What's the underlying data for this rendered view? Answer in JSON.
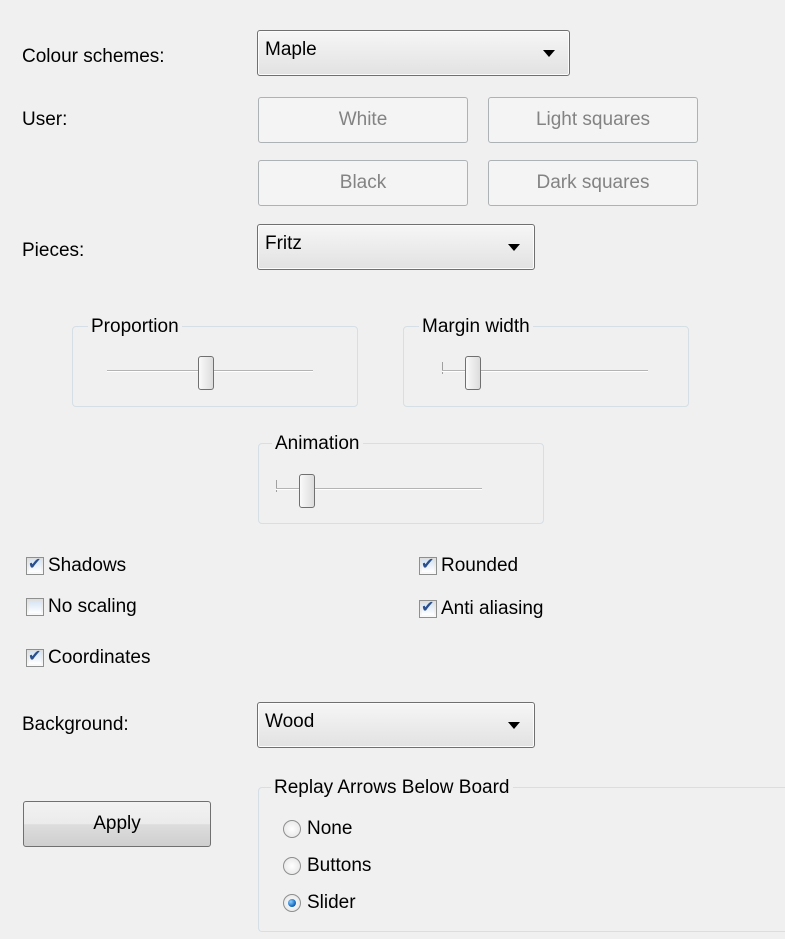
{
  "colour_schemes": {
    "label": "Colour schemes:",
    "value": "Maple"
  },
  "user": {
    "label": "User:",
    "white": "White",
    "light_squares": "Light squares",
    "black": "Black",
    "dark_squares": "Dark squares"
  },
  "pieces": {
    "label": "Pieces:",
    "value": "Fritz"
  },
  "sliders": {
    "proportion": {
      "title": "Proportion",
      "level": 0.48
    },
    "margin_width": {
      "title": "Margin width",
      "level": 0.15
    },
    "animation": {
      "title": "Animation",
      "level": 0.15
    }
  },
  "checkboxes": {
    "shadows": {
      "label": "Shadows",
      "checked": true
    },
    "no_scaling": {
      "label": "No scaling",
      "checked": false
    },
    "coordinates": {
      "label": "Coordinates",
      "checked": true
    },
    "rounded": {
      "label": "Rounded",
      "checked": true
    },
    "anti_aliasing": {
      "label": "Anti aliasing",
      "checked": true
    }
  },
  "background": {
    "label": "Background:",
    "value": "Wood"
  },
  "apply_label": "Apply",
  "replay_arrows": {
    "title": "Replay Arrows Below Board",
    "none": "None",
    "buttons": "Buttons",
    "slider": "Slider",
    "selected": "Slider"
  },
  "icons": {
    "dropdown": "chevron-down-icon",
    "check": "checkmark-icon"
  }
}
